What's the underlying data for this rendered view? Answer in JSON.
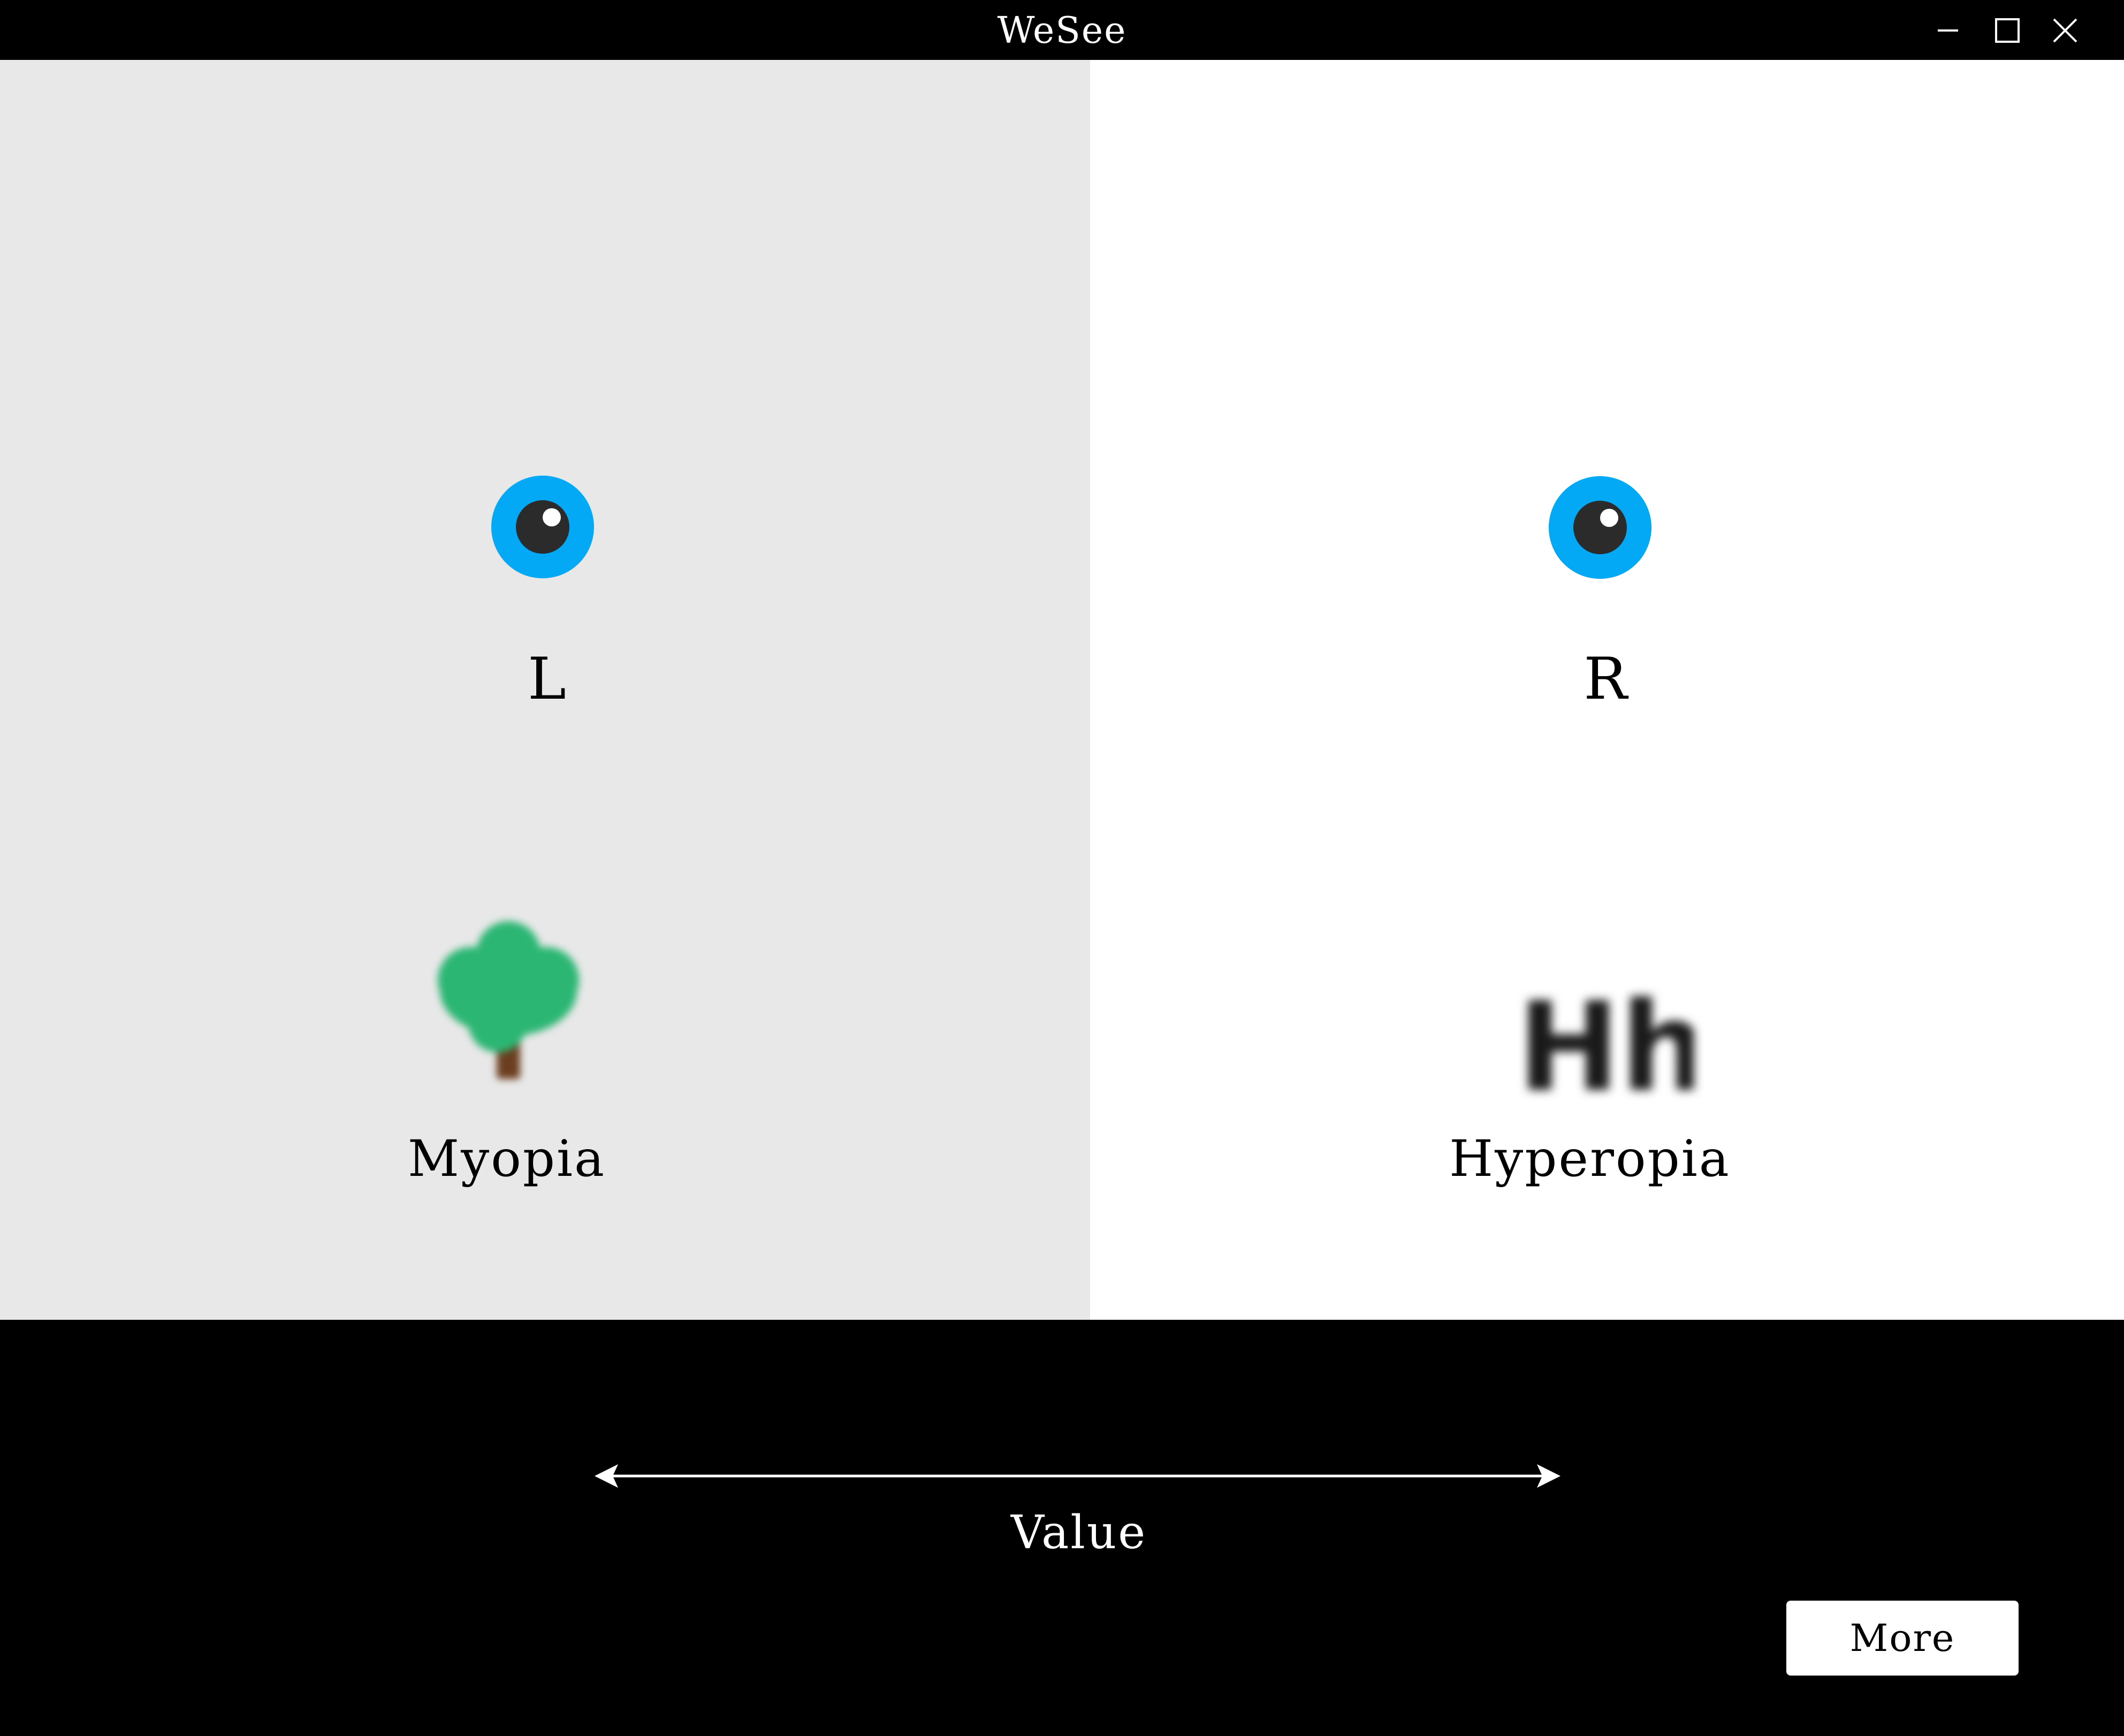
{
  "window": {
    "title": "WeSee",
    "controls": [
      "minimize-icon",
      "maximize-icon",
      "close-icon"
    ]
  },
  "left_panel": {
    "icon": "eye-icon",
    "eye_label": "L",
    "image": "blurred-tree-icon",
    "condition": "Myopia",
    "background": "#e8e8e8"
  },
  "right_panel": {
    "icon": "eye-icon",
    "eye_label": "R",
    "image": "blurred-letters-icon",
    "image_text": "Hh",
    "condition": "Hyperopia",
    "background": "#ffffff"
  },
  "bottom": {
    "arrow_icon": "double-arrow-icon",
    "value_label": "Value",
    "more_button": "More"
  },
  "colors": {
    "eye_iris": "#03a9f4",
    "pupil": "#2b2b2b",
    "tree_foliage": "#2bb673",
    "tree_trunk": "#6b3e1f",
    "chrome": "#000000"
  }
}
